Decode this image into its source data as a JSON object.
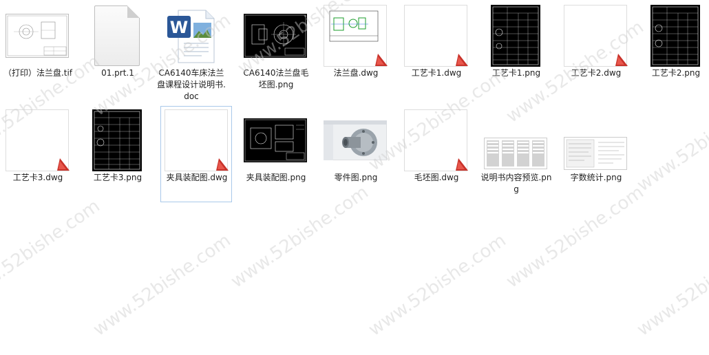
{
  "watermark": "www.52bishe.com",
  "files": [
    {
      "name": "（打印）法兰盘.tif",
      "icon": "tif-drawing-thumb"
    },
    {
      "name": "01.prt.1",
      "icon": "blank-file-icon"
    },
    {
      "name": "CA6140车床法兰盘课程设计说明书.doc",
      "icon": "word-doc-icon"
    },
    {
      "name": "CA6140法兰盘毛坯图.png",
      "icon": "black-drawing-thumb"
    },
    {
      "name": "法兰盘.dwg",
      "icon": "dwg-thumb"
    },
    {
      "name": "工艺卡1.dwg",
      "icon": "dwg-icon"
    },
    {
      "name": "工艺卡1.png",
      "icon": "black-table-thumb"
    },
    {
      "name": "工艺卡2.dwg",
      "icon": "dwg-icon"
    },
    {
      "name": "工艺卡2.png",
      "icon": "black-table-thumb"
    },
    {
      "name": "工艺卡3.dwg",
      "icon": "dwg-icon"
    },
    {
      "name": "工艺卡3.png",
      "icon": "black-table-thumb"
    },
    {
      "name": "夹具装配图.dwg",
      "icon": "dwg-icon"
    },
    {
      "name": "夹具装配图.png",
      "icon": "black-drawing-thumb"
    },
    {
      "name": "零件图.png",
      "icon": "3d-part-thumb"
    },
    {
      "name": "毛坯图.dwg",
      "icon": "dwg-icon"
    },
    {
      "name": "说明书内容预览.png",
      "icon": "doc-preview-thumb"
    },
    {
      "name": "字数统计.png",
      "icon": "doc-preview-thumb"
    }
  ],
  "colors": {
    "selection_border": "#a8c8ea",
    "dwg_badge": "#c8322a",
    "word_blue": "#2b5797"
  }
}
